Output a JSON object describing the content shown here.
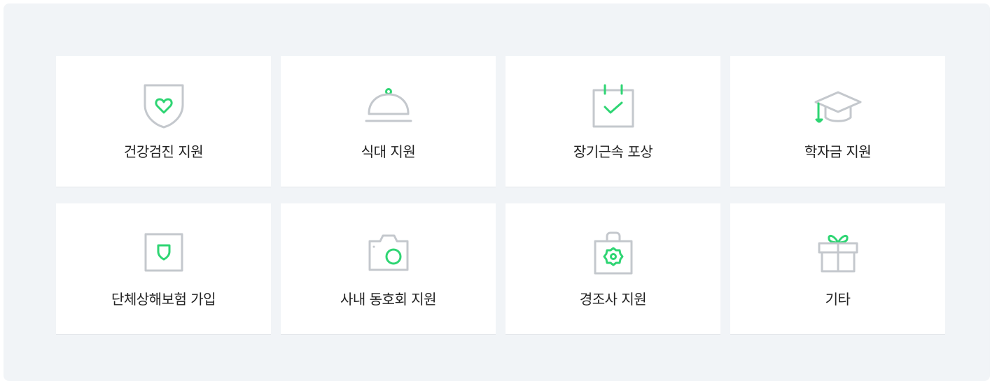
{
  "colors": {
    "panel_background": "#f1f4f7",
    "card_background": "#ffffff",
    "icon_stroke": "#c4c8cd",
    "accent_green": "#2ed573",
    "label_text": "#222222"
  },
  "benefits": [
    {
      "label": "건강검진 지원",
      "icon": "shield-heart-icon"
    },
    {
      "label": "식대 지원",
      "icon": "cloche-icon"
    },
    {
      "label": "장기근속 포상",
      "icon": "calendar-check-icon"
    },
    {
      "label": "학자금 지원",
      "icon": "graduation-cap-icon"
    },
    {
      "label": "단체상해보험 가입",
      "icon": "insurance-shield-icon"
    },
    {
      "label": "사내 동호회 지원",
      "icon": "camera-icon"
    },
    {
      "label": "경조사 지원",
      "icon": "flower-bag-icon"
    },
    {
      "label": "기타",
      "icon": "gift-icon"
    }
  ]
}
